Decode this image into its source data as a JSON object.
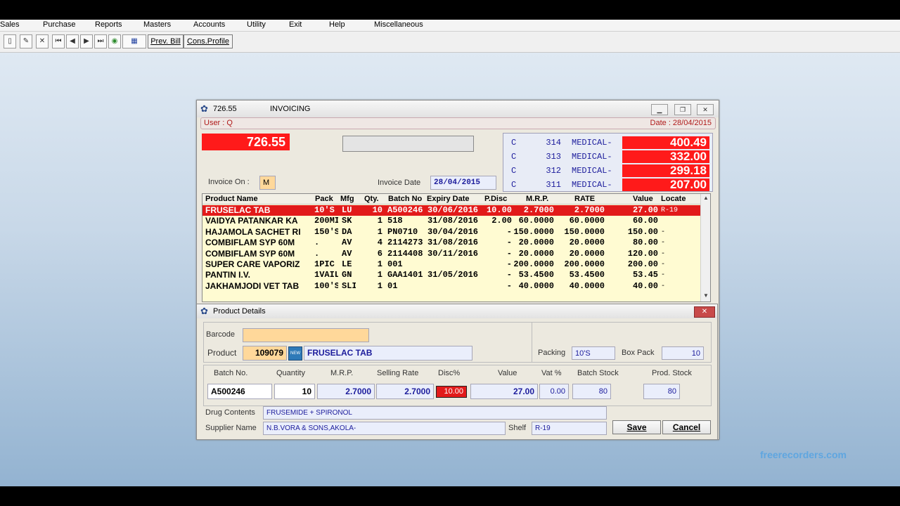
{
  "menu": [
    "Sales",
    "Purchase",
    "Reports",
    "Masters",
    "Accounts",
    "Utility",
    "Exit",
    "Help",
    "Miscellaneous"
  ],
  "toolbar": {
    "prev_bill": "Prev. Bill",
    "cons_profile": "Cons.Profile"
  },
  "invoice_window": {
    "title_amount": "726.55",
    "title": "INVOICING",
    "user": "User : Q",
    "date": "Date : 28/04/2015",
    "total": "726.55",
    "invoice_on_label": "Invoice On :",
    "invoice_on_value": "M",
    "invoice_date_label": "Invoice Date",
    "invoice_date_value": "28/04/2015",
    "recent_bills": [
      {
        "type": "C",
        "no": "314",
        "name": "MEDICAL-",
        "amount": "400.49"
      },
      {
        "type": "C",
        "no": "313",
        "name": "MEDICAL-",
        "amount": "332.00"
      },
      {
        "type": "C",
        "no": "312",
        "name": "MEDICAL-",
        "amount": "299.18"
      },
      {
        "type": "C",
        "no": "311",
        "name": "MEDICAL-",
        "amount": "207.00"
      }
    ],
    "table_headers": {
      "product": "Product Name",
      "pack": "Pack",
      "mfg": "Mfg",
      "qty": "Qty.",
      "batch": "Batch No",
      "expiry": "Expiry Date",
      "pdisc": "P.Disc",
      "mrp": "M.R.P.",
      "rate": "RATE",
      "value": "Value",
      "locate": "Locate"
    },
    "rows": [
      {
        "product": "FRUSELAC TAB",
        "pack": "10'S",
        "mfg": "LU",
        "qty": "10",
        "batch": "A500246",
        "expiry": "30/06/2016",
        "pdisc": "10.00",
        "mrp": "2.7000",
        "rate": "2.7000",
        "value": "27.00",
        "locate": "R-19"
      },
      {
        "product": "VAIDYA PATANKAR KA",
        "pack": "200MI",
        "mfg": "SK",
        "qty": "1",
        "batch": "518",
        "expiry": "31/08/2016",
        "pdisc": "2.00",
        "mrp": "60.0000",
        "rate": "60.0000",
        "value": "60.00",
        "locate": ""
      },
      {
        "product": "HAJAMOLA SACHET RI",
        "pack": "150'S",
        "mfg": "DA",
        "qty": "1",
        "batch": "PN0710",
        "expiry": "30/04/2016",
        "pdisc": "-",
        "mrp": "150.0000",
        "rate": "150.0000",
        "value": "150.00",
        "locate": "-"
      },
      {
        "product": "COMBIFLAM SYP  60M",
        "pack": ".",
        "mfg": "AV",
        "qty": "4",
        "batch": "2114273",
        "expiry": "31/08/2016",
        "pdisc": "-",
        "mrp": "20.0000",
        "rate": "20.0000",
        "value": "80.00",
        "locate": "-"
      },
      {
        "product": "COMBIFLAM SYP  60M",
        "pack": ".",
        "mfg": "AV",
        "qty": "6",
        "batch": "2114408",
        "expiry": "30/11/2016",
        "pdisc": "-",
        "mrp": "20.0000",
        "rate": "20.0000",
        "value": "120.00",
        "locate": "-"
      },
      {
        "product": "SUPER CARE VAPORIZ",
        "pack": "1PIC",
        "mfg": "LE",
        "qty": "1",
        "batch": "001",
        "expiry": "",
        "pdisc": "-",
        "mrp": "200.0000",
        "rate": "200.0000",
        "value": "200.00",
        "locate": "-"
      },
      {
        "product": "PANTIN I.V.",
        "pack": "1VAIL",
        "mfg": "GN",
        "qty": "1",
        "batch": "GAA1401",
        "expiry": "31/05/2016",
        "pdisc": "-",
        "mrp": "53.4500",
        "rate": "53.4500",
        "value": "53.45",
        "locate": "-"
      },
      {
        "product": "JAKHAMJODI VET TAB",
        "pack": "100'S",
        "mfg": "SLI",
        "qty": "1",
        "batch": "01",
        "expiry": "",
        "pdisc": "-",
        "mrp": "40.0000",
        "rate": "40.0000",
        "value": "40.00",
        "locate": "-"
      }
    ]
  },
  "product_details": {
    "title": "Product Details",
    "barcode_label": "Barcode",
    "barcode_value": "",
    "product_label": "Product",
    "product_code": "109079",
    "product_name": "FRUSELAC TAB",
    "new_icon": "NEW",
    "packing_label": "Packing",
    "packing_value": "10'S",
    "box_pack_label": "Box Pack",
    "box_pack_value": "10",
    "headers": {
      "batch": "Batch No.",
      "qty": "Quantity",
      "mrp": "M.R.P.",
      "selling": "Selling Rate",
      "disc": "Disc%",
      "value": "Value",
      "vat": "Vat %",
      "batch_stock": "Batch Stock",
      "prod_stock": "Prod. Stock"
    },
    "values": {
      "batch": "A500246",
      "qty": "10",
      "mrp": "2.7000",
      "selling": "2.7000",
      "disc": "10.00",
      "value": "27.00",
      "vat": "0.00",
      "batch_stock": "80",
      "prod_stock": "80"
    },
    "drug_contents_label": "Drug Contents",
    "drug_contents_value": "FRUSEMIDE + SPIRONOL",
    "supplier_label": "Supplier Name",
    "supplier_value": "N.B.VORA & SONS,AKOLA-",
    "shelf_label": "Shelf",
    "shelf_value": "R-19",
    "save": "Save",
    "cancel": "Cancel"
  },
  "watermark": "freerecorders.com",
  "colors": {
    "accent_red": "#ff1a1a",
    "highlight_red": "#e21a1a",
    "row_bg": "#fffbd2",
    "field_blue": "#1c1c9c"
  }
}
